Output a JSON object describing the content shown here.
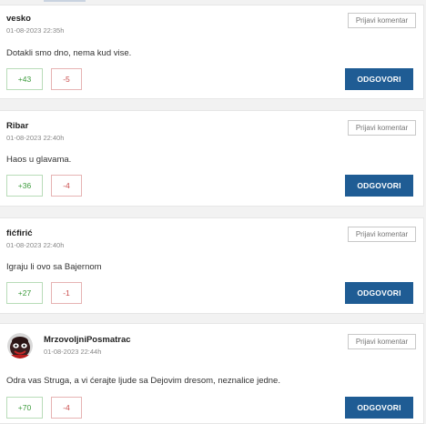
{
  "comments": [
    {
      "author": "vesko",
      "date": "01-08-2023 22:35h",
      "text": "Dotakli smo dno, nema kud vise.",
      "upvotes": "+43",
      "downvotes": "-5"
    },
    {
      "author": "Ribar",
      "date": "01-08-2023 22:40h",
      "text": "Haos u glavama.",
      "upvotes": "+36",
      "downvotes": "-4"
    },
    {
      "author": "fićfirić",
      "date": "01-08-2023 22:40h",
      "text": "Igraju li ovo sa Bajernom",
      "upvotes": "+27",
      "downvotes": "-1"
    },
    {
      "author": "MrzovoljniPosmatrac",
      "date": "01-08-2023 22:44h",
      "text": "Odra vas Struga, a vi ćerajte ljude sa Dejovim dresom, neznalice jedne.",
      "upvotes": "+70",
      "downvotes": "-4"
    }
  ],
  "actions": {
    "report_label": "Prijavi komentar",
    "reply_label": "ODGOVORI"
  },
  "colors": {
    "reply_button": "#1f5c94",
    "upvote": "#3a9a3a",
    "downvote": "#c94b4b"
  }
}
